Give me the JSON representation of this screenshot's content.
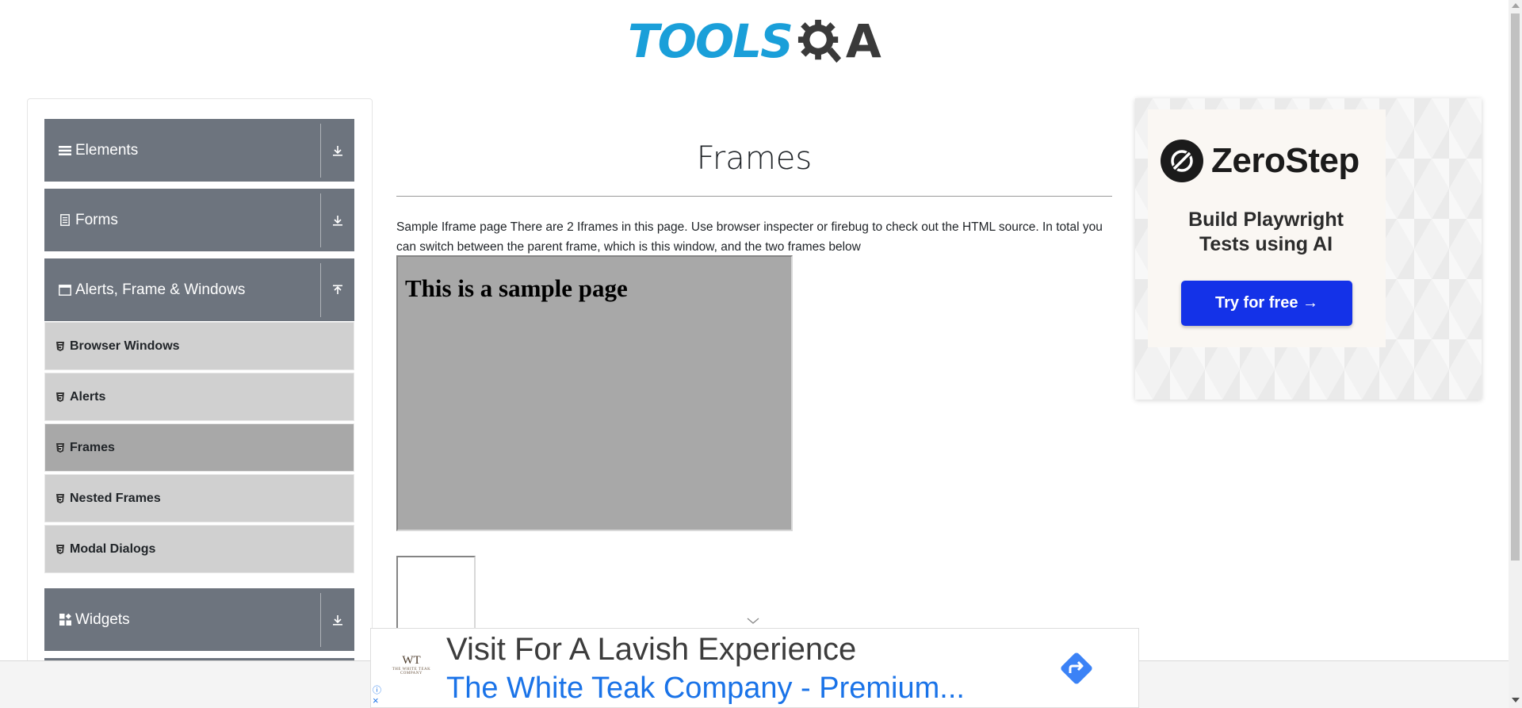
{
  "header": {
    "logo_part1": "TOOLS",
    "logo_part2": "A"
  },
  "sidebar": {
    "groups": [
      {
        "label": "Elements",
        "icon": "list-icon",
        "expanded": false
      },
      {
        "label": "Forms",
        "icon": "form-icon",
        "expanded": false
      },
      {
        "label": "Alerts, Frame & Windows",
        "icon": "window-icon",
        "expanded": true
      },
      {
        "label": "Widgets",
        "icon": "widgets-icon",
        "expanded": false
      }
    ],
    "alerts_items": [
      {
        "label": "Browser Windows",
        "active": false
      },
      {
        "label": "Alerts",
        "active": false
      },
      {
        "label": "Frames",
        "active": true
      },
      {
        "label": "Nested Frames",
        "active": false
      },
      {
        "label": "Modal Dialogs",
        "active": false
      }
    ]
  },
  "main": {
    "title": "Frames",
    "description": "Sample Iframe page There are 2 Iframes in this page. Use browser inspecter or firebug to check out the HTML source. In total you can switch between the parent frame, which is this window, and the two frames below",
    "frame1_heading": "This is a sample page"
  },
  "right_ad": {
    "brand": "ZeroStep",
    "tagline_line1": "Build Playwright",
    "tagline_line2": "Tests using AI",
    "cta": "Try for free →"
  },
  "bottom_ad": {
    "logo_text": "WT",
    "logo_subtext": "THE WHITE TEAK COMPANY",
    "headline": "Visit For A Lavish Experience",
    "subline": "The White Teak Company - Premium...",
    "info_icon": "ⓘ",
    "close_icon": "×"
  },
  "colors": {
    "accent_blue": "#1a9fd9",
    "group_header": "#6d747e",
    "sub_item": "#d0d0d0",
    "sub_item_active": "#a8a8a8",
    "cta_blue": "#1432e8",
    "ad_link_blue": "#1a73e8"
  }
}
